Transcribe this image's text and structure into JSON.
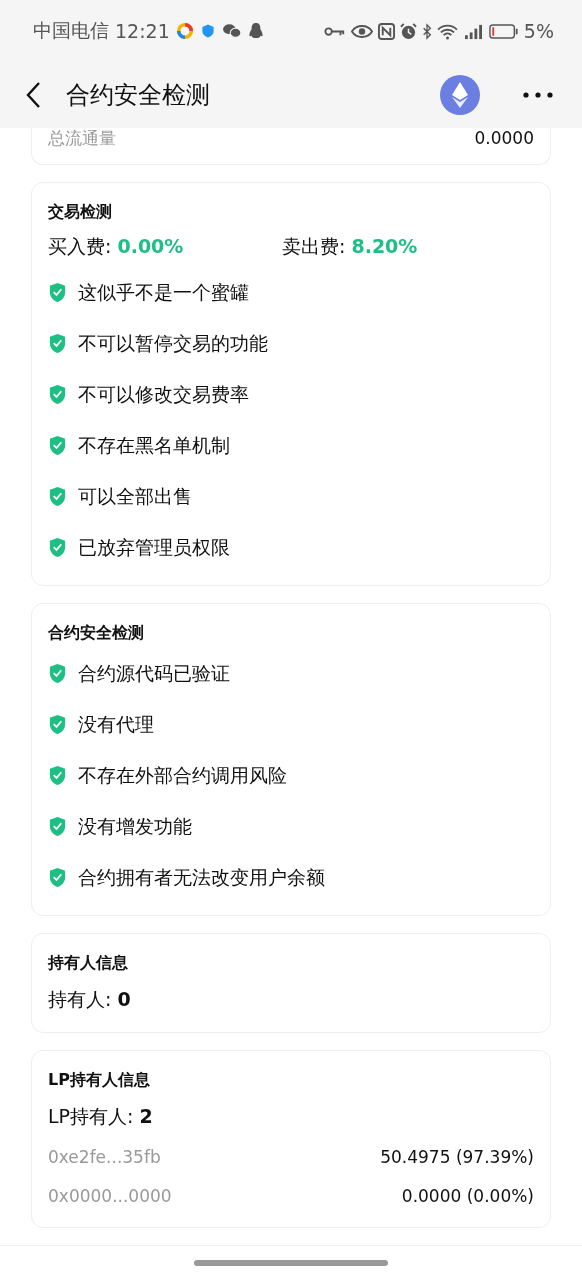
{
  "status_bar": {
    "carrier": "中国电信",
    "time": "12:21",
    "battery": "5%"
  },
  "header": {
    "title": "合约安全检测"
  },
  "supply_card": {
    "label": "总流通量",
    "value": "0.0000"
  },
  "trade_check": {
    "title": "交易检测",
    "fees": [
      {
        "label": "买入费: ",
        "value": "0.00%"
      },
      {
        "label": "卖出费: ",
        "value": "8.20%"
      }
    ],
    "items": [
      {
        "text": "这似乎不是一个蜜罐",
        "passed": true
      },
      {
        "text": "不可以暂停交易的功能",
        "passed": true
      },
      {
        "text": "不可以修改交易费率",
        "passed": true
      },
      {
        "text": "不存在黑名单机制",
        "passed": true
      },
      {
        "text": "可以全部出售",
        "passed": true
      },
      {
        "text": "已放弃管理员权限",
        "passed": true
      }
    ]
  },
  "contract_check": {
    "title": "合约安全检测",
    "items": [
      {
        "text": "合约源代码已验证",
        "passed": true
      },
      {
        "text": "没有代理",
        "passed": true
      },
      {
        "text": "不存在外部合约调用风险",
        "passed": true
      },
      {
        "text": "没有增发功能",
        "passed": true
      },
      {
        "text": "合约拥有者无法改变用户余额",
        "passed": true
      }
    ]
  },
  "holder_info": {
    "title": "持有人信息",
    "count": "持有人: **0**"
  },
  "lp_holder_info": {
    "title": "LP持有人信息",
    "count": "LP持有人: **2**",
    "rows": [
      {
        "address": "0xe2fe...35fb",
        "amount": "50.4975 (97.39%)"
      },
      {
        "address": "0x0000...0000",
        "amount": "0.0000 (0.00%)"
      }
    ]
  }
}
